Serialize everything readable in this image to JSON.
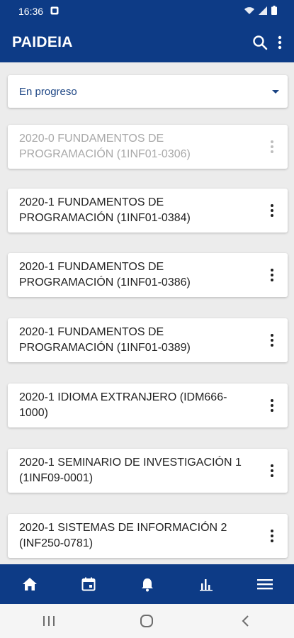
{
  "status_bar": {
    "time": "16:36",
    "icons": [
      "notification-icon",
      "wifi-icon",
      "signal-icon",
      "battery-icon"
    ]
  },
  "app_bar": {
    "title": "PAIDEIA",
    "actions": [
      "search-icon",
      "overflow-menu-icon"
    ],
    "color": "#0d3b86"
  },
  "filter": {
    "selected": "En progreso"
  },
  "courses": [
    {
      "title": "2020-0 FUNDAMENTOS DE PROGRAMACIÓN (1INF01-0306)",
      "disabled": true
    },
    {
      "title": "2020-1 FUNDAMENTOS DE PROGRAMACIÓN (1INF01-0384)",
      "disabled": false
    },
    {
      "title": "2020-1 FUNDAMENTOS DE PROGRAMACIÓN (1INF01-0386)",
      "disabled": false
    },
    {
      "title": "2020-1 FUNDAMENTOS DE PROGRAMACIÓN (1INF01-0389)",
      "disabled": false
    },
    {
      "title": "2020-1 IDIOMA EXTRANJERO (IDM666-1000)",
      "disabled": false
    },
    {
      "title": "2020-1 SEMINARIO DE INVESTIGACIÓN 1 (1INF09-0001)",
      "disabled": false
    },
    {
      "title": "2020-1 SISTEMAS DE INFORMACIÓN 2 (INF250-0781)",
      "disabled": false
    }
  ],
  "bottom_nav": [
    "home-icon",
    "calendar-icon",
    "notifications-icon",
    "stats-icon",
    "menu-icon"
  ],
  "system_nav": [
    "recent-apps-icon",
    "home-circle-icon",
    "back-icon"
  ]
}
